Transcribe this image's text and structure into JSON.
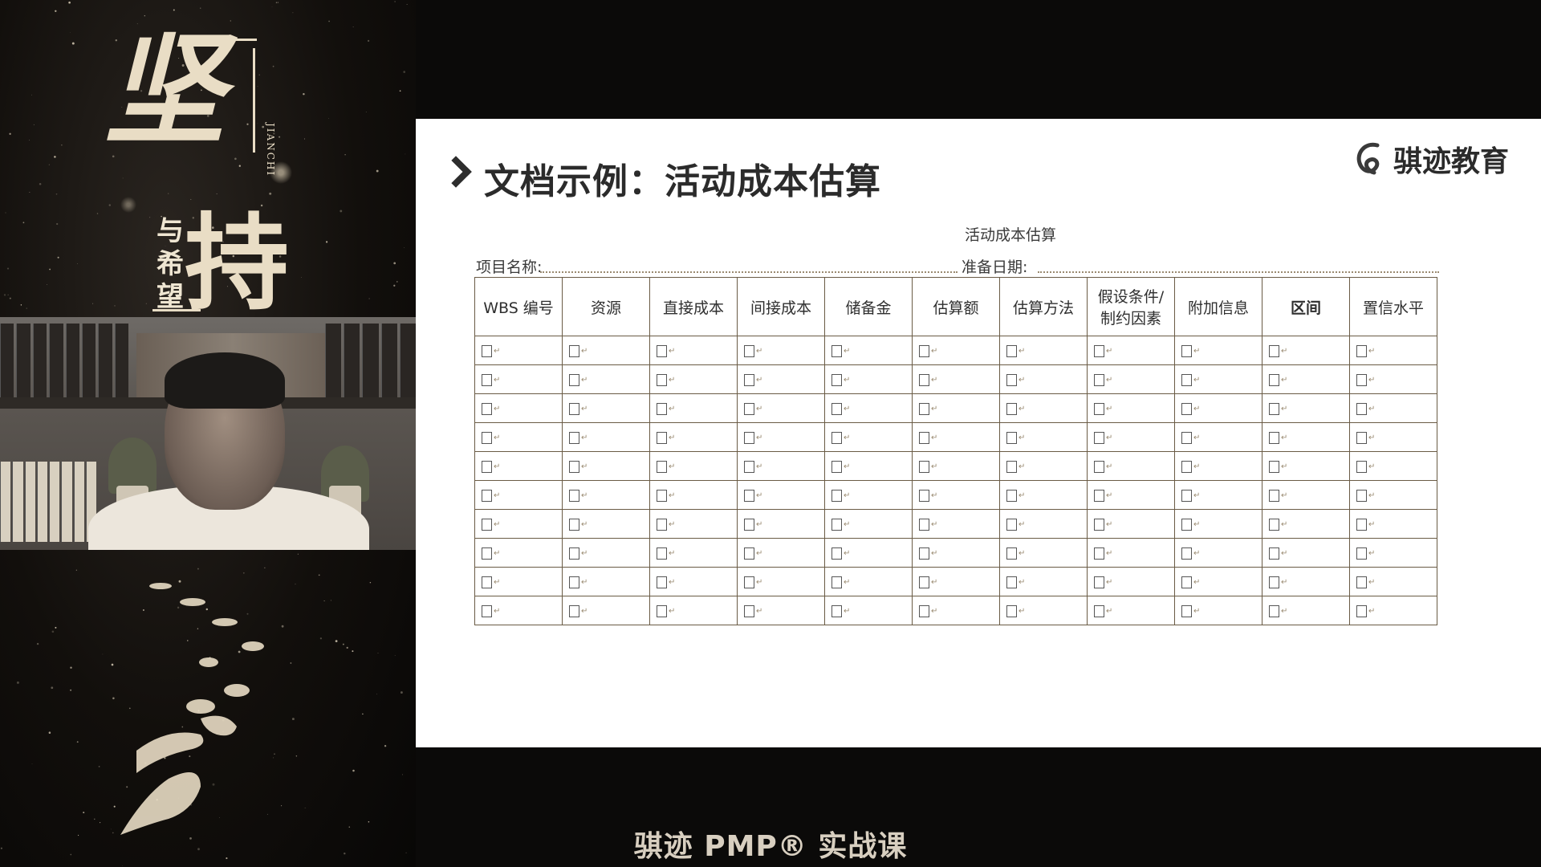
{
  "poster": {
    "title_char1": "坚",
    "title_char2": "持",
    "subtitle": "与希望",
    "latin": "JIANCHI"
  },
  "slide": {
    "title": "文档示例：活动成本估算",
    "brand": "骐迹教育",
    "document": {
      "title": "活动成本估算",
      "project_name_label": "项目名称:",
      "prep_date_label": "准备日期:",
      "columns": [
        {
          "label": "WBS 编号",
          "strong": false
        },
        {
          "label": "资源",
          "strong": false
        },
        {
          "label": "直接成本",
          "strong": false
        },
        {
          "label": "间接成本",
          "strong": false
        },
        {
          "label": "储备金",
          "strong": false
        },
        {
          "label": "估算额",
          "strong": false
        },
        {
          "label": "估算方法",
          "strong": false
        },
        {
          "label": "假设条件/制约因素",
          "strong": false
        },
        {
          "label": "附加信息",
          "strong": false
        },
        {
          "label": "区间",
          "strong": true
        },
        {
          "label": "置信水平",
          "strong": false
        }
      ],
      "row_count": 10
    }
  },
  "caption": "骐迹 PMP® 实战课",
  "colors": {
    "slide_bg": "#ffffff",
    "frame_bg": "#0b0a09",
    "table_border": "#6a5b45",
    "poster_text": "#e9ddc5"
  }
}
